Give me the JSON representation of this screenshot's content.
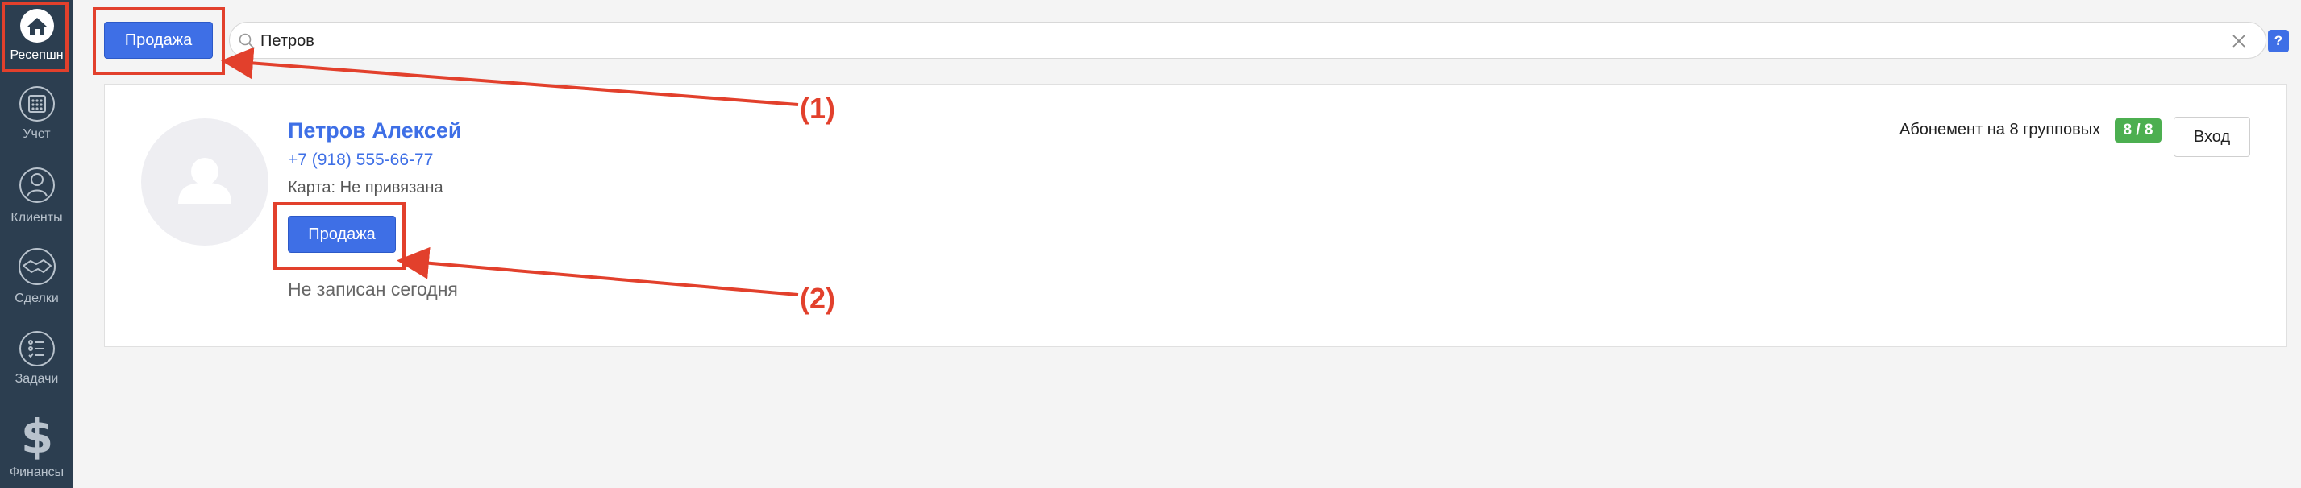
{
  "sidebar": {
    "items": [
      {
        "label": "Ресепшн",
        "icon": "home-icon",
        "active": true
      },
      {
        "label": "Учет",
        "icon": "calendar-icon",
        "active": false
      },
      {
        "label": "Клиенты",
        "icon": "clients-icon",
        "active": false
      },
      {
        "label": "Сделки",
        "icon": "handshake-icon",
        "active": false
      },
      {
        "label": "Задачи",
        "icon": "tasks-icon",
        "active": false
      },
      {
        "label": "Финансы",
        "icon": "dollar-icon",
        "active": false
      }
    ]
  },
  "toolbar": {
    "sale_label": "Продажа",
    "search_value": "Петров",
    "help_label": "?"
  },
  "client": {
    "name": "Петров Алексей",
    "phone": "+7 (918) 555-66-77",
    "card_status": "Карта: Не привязана",
    "sale_label": "Продажа",
    "attendance_status": "Не записан сегодня",
    "subscription_label": "Абонемент на 8 групповых",
    "subscription_count": "8 / 8",
    "entry_label": "Вход"
  },
  "annotations": {
    "callout_1": "(1)",
    "callout_2": "(2)"
  },
  "colors": {
    "accent": "#3e6fe6",
    "annotation": "#e2402c",
    "badge": "#4caf50",
    "sidebar": "#2c3e50"
  }
}
